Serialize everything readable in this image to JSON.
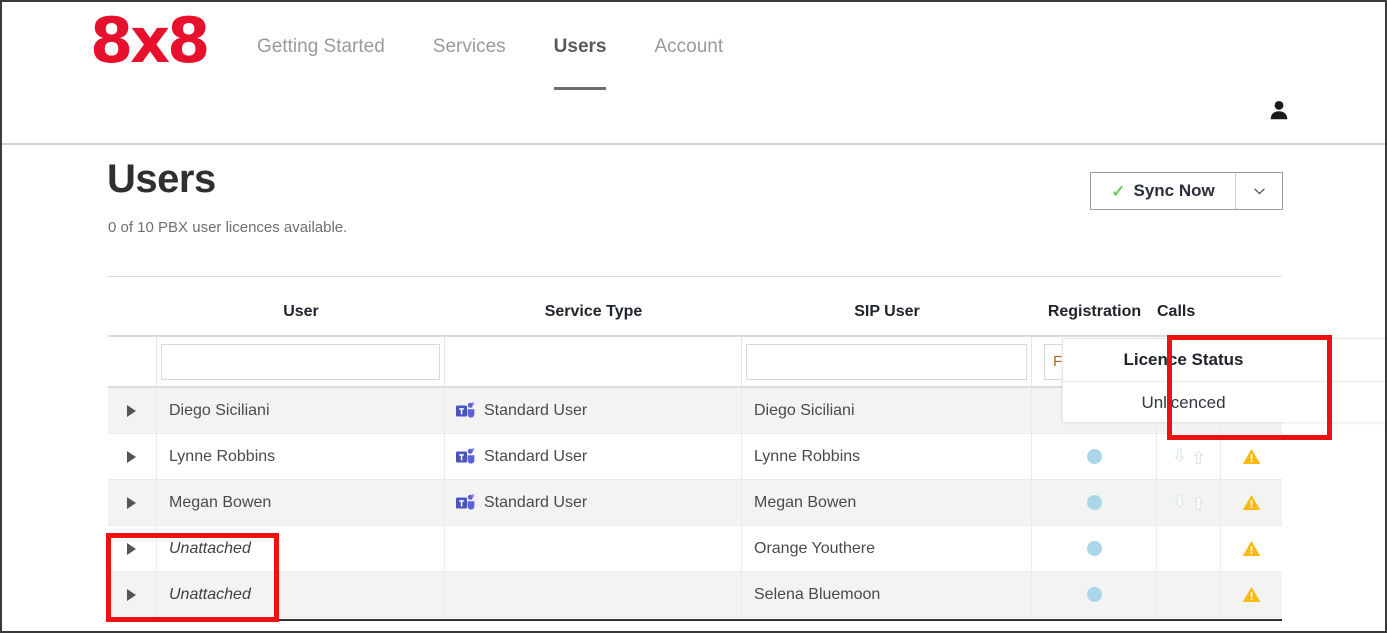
{
  "brand": {
    "logo_text": "8x8",
    "logo_color": "#e8112d"
  },
  "nav": {
    "items": [
      {
        "label": "Getting Started",
        "active": false
      },
      {
        "label": "Services",
        "active": false
      },
      {
        "label": "Users",
        "active": true
      },
      {
        "label": "Account",
        "active": false
      }
    ],
    "account_icon": "user-icon"
  },
  "page": {
    "title": "Users",
    "subtitle": "0 of 10 PBX user licences available."
  },
  "toolbar": {
    "sync_label": "Sync Now",
    "sync_check_icon": "check-icon",
    "sync_dropdown_icon": "chevron-down-icon",
    "sync_check_color": "#6ecb63"
  },
  "table": {
    "columns": [
      {
        "key": "expander",
        "label": ""
      },
      {
        "key": "user",
        "label": "User"
      },
      {
        "key": "service_type",
        "label": "Service Type"
      },
      {
        "key": "sip_user",
        "label": "SIP User"
      },
      {
        "key": "registration",
        "label": "Registration"
      },
      {
        "key": "calls",
        "label": "Calls"
      },
      {
        "key": "licence",
        "label": ""
      }
    ],
    "filters": {
      "user_value": "",
      "user_placeholder": "",
      "sip_value": "",
      "sip_placeholder": "",
      "registration_value": "F"
    },
    "rows": [
      {
        "user": "Diego Siciliani",
        "user_italic": false,
        "service_type": "Standard User",
        "service_icon": "teams-icon",
        "sip_user": "Diego Siciliani",
        "registration_icon": "dot-icon",
        "calls_icons": "download-upload-arrows-icon",
        "licence_icon": "warning-triangle-icon"
      },
      {
        "user": "Lynne Robbins",
        "user_italic": false,
        "service_type": "Standard User",
        "service_icon": "teams-icon",
        "sip_user": "Lynne Robbins",
        "registration_icon": "dot-icon",
        "calls_icons": "download-upload-arrows-icon",
        "licence_icon": "warning-triangle-icon"
      },
      {
        "user": "Megan Bowen",
        "user_italic": false,
        "service_type": "Standard User",
        "service_icon": "teams-icon",
        "sip_user": "Megan Bowen",
        "registration_icon": "dot-icon",
        "calls_icons": "download-upload-arrows-icon",
        "licence_icon": "warning-triangle-icon"
      },
      {
        "user": "Unattached",
        "user_italic": true,
        "service_type": "",
        "service_icon": "",
        "sip_user": "Orange Youthere",
        "registration_icon": "dot-icon",
        "calls_icons": "",
        "licence_icon": "warning-triangle-icon"
      },
      {
        "user": "Unattached",
        "user_italic": true,
        "service_type": "",
        "service_icon": "",
        "sip_user": "Selena Bluemoon",
        "registration_icon": "dot-icon",
        "calls_icons": "",
        "licence_icon": "warning-triangle-icon"
      }
    ]
  },
  "licence_panel": {
    "title": "Licence Status",
    "value": "Unlicenced"
  },
  "annotations": {
    "color": "#ee1111",
    "boxes": [
      {
        "name": "licence-status-highlight"
      },
      {
        "name": "unattached-rows-highlight"
      }
    ]
  }
}
